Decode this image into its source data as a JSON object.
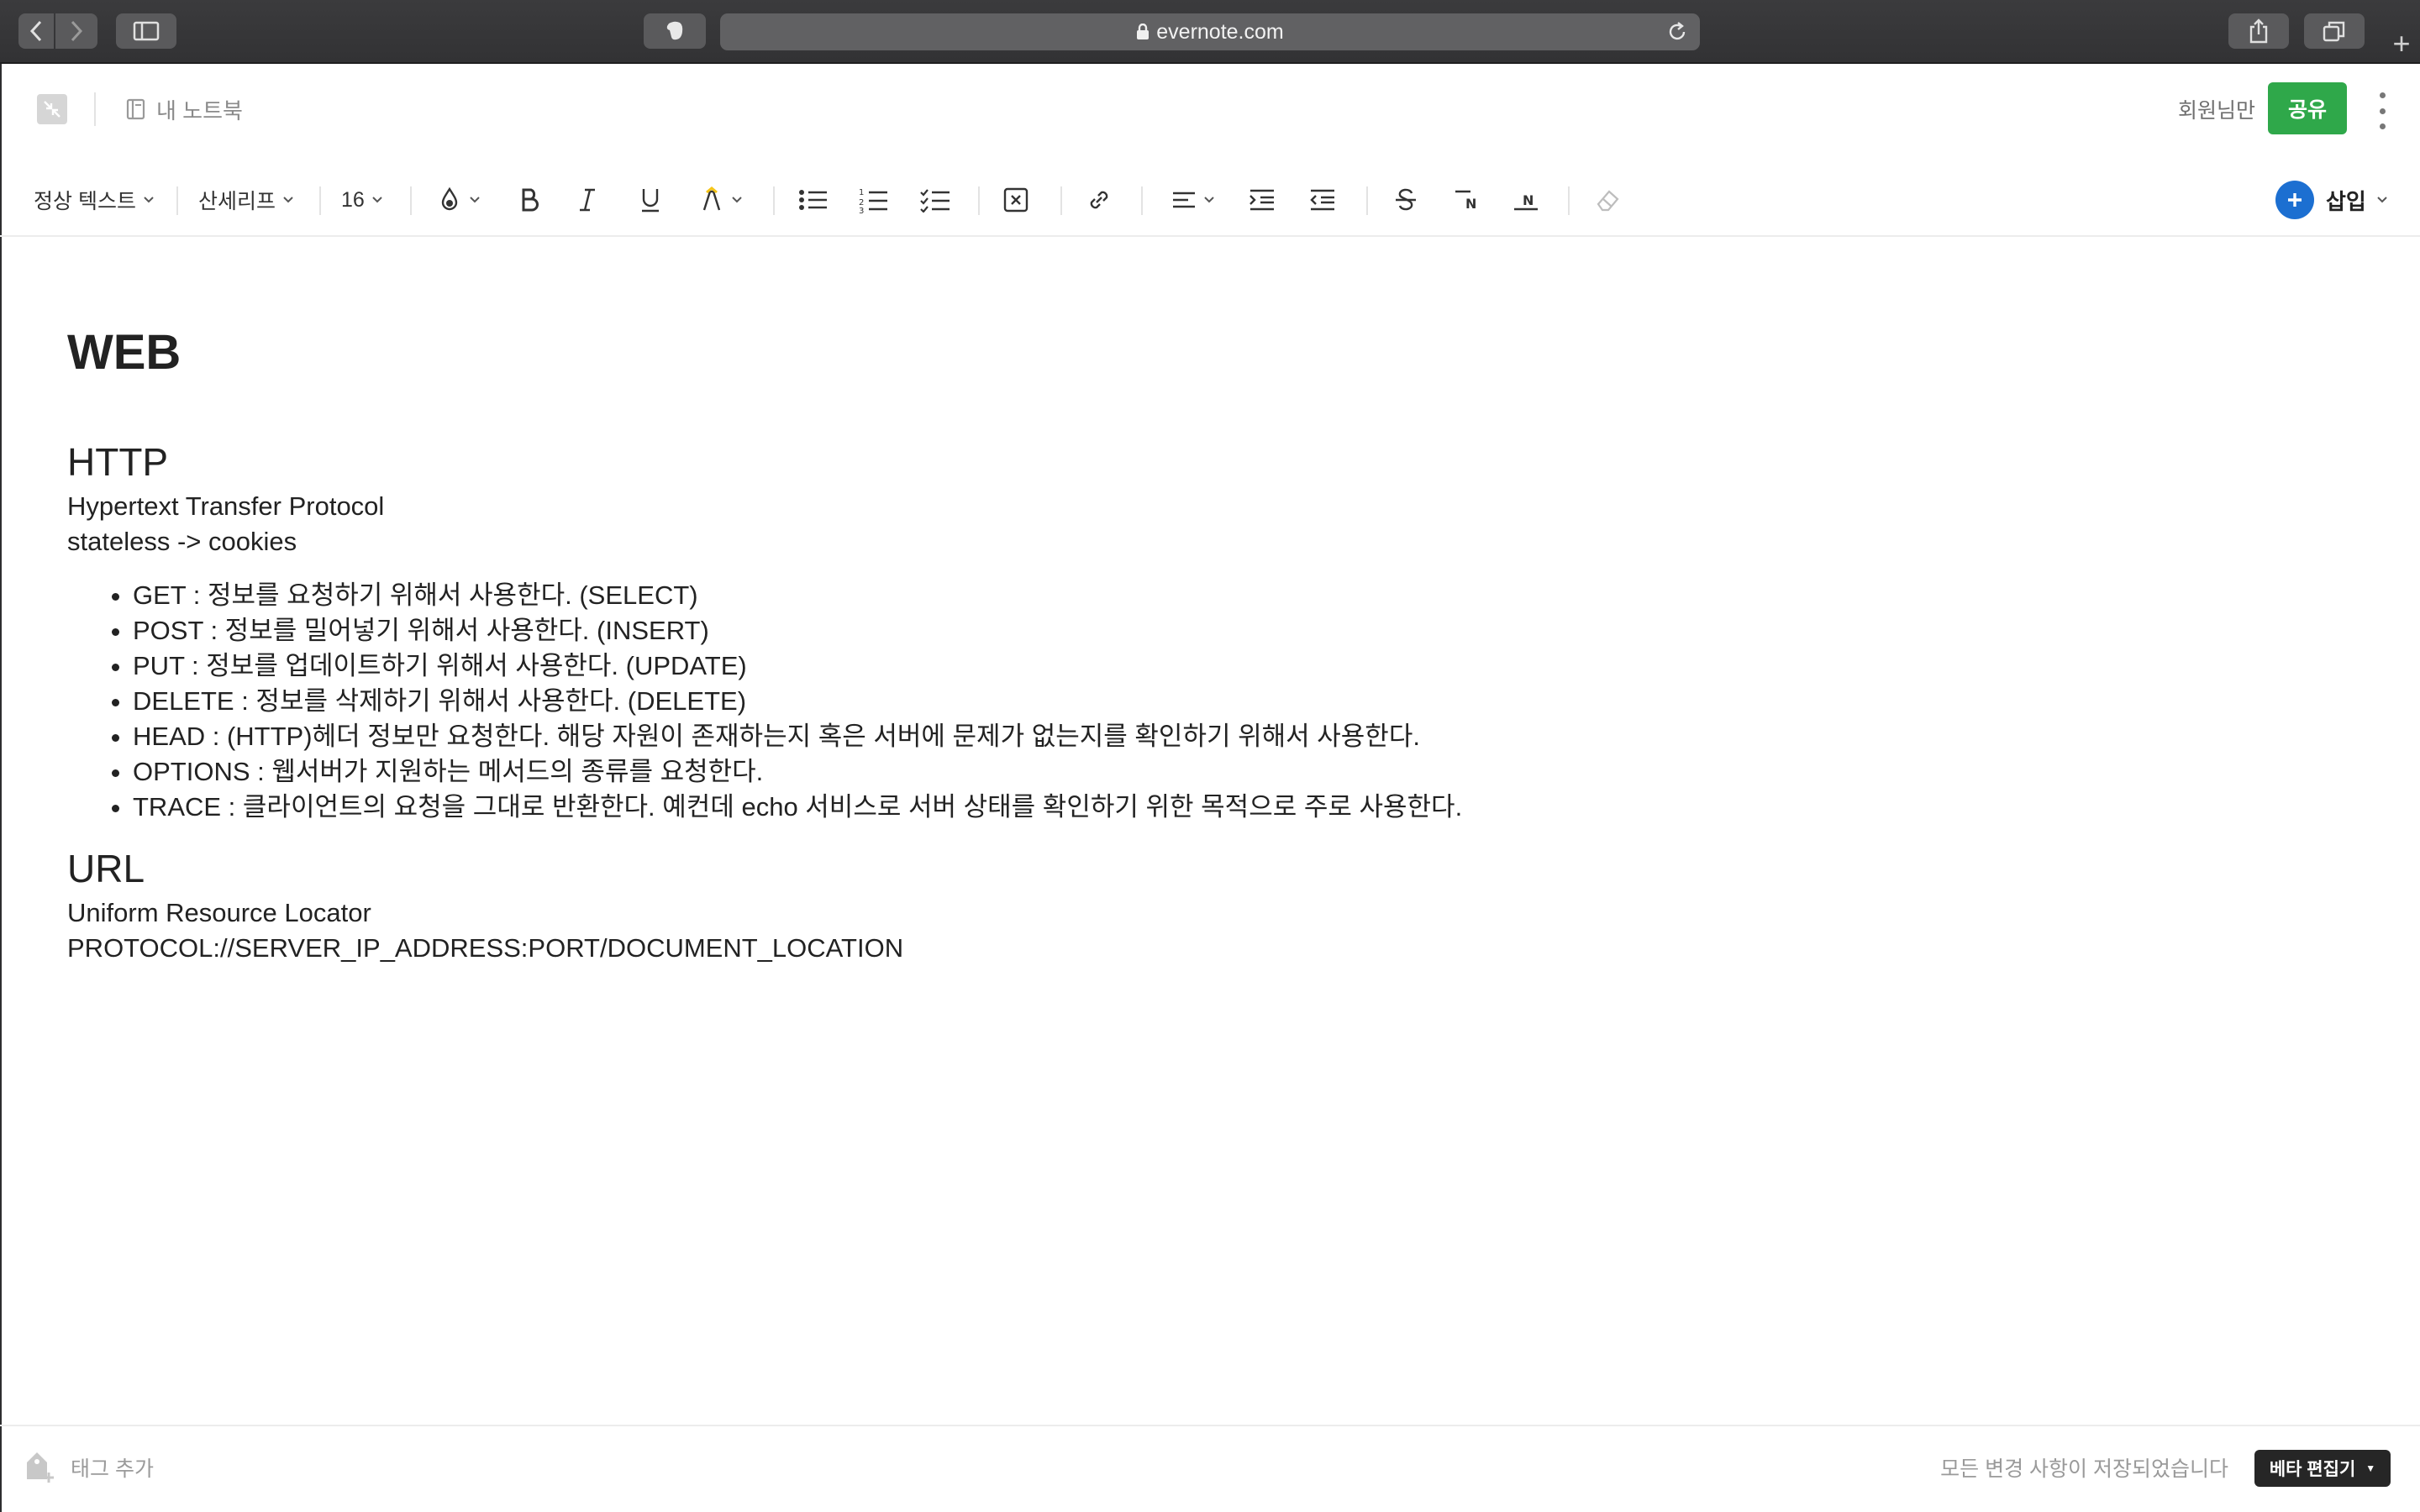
{
  "browser": {
    "url": "evernote.com",
    "icons": [
      "back-icon",
      "forward-icon",
      "sidebar-icon",
      "evernote-tab-icon",
      "lock-icon",
      "reload-icon",
      "share-icon",
      "tabs-icon",
      "new-tab-icon"
    ]
  },
  "header": {
    "notebook": "내 노트북",
    "members": "회원님만",
    "share_label": "공유"
  },
  "toolbar": {
    "paragraph_style": "정상 텍스트",
    "font": "산세리프",
    "font_size": "16",
    "insert_label": "삽입"
  },
  "note": {
    "title": "WEB",
    "http_heading": "HTTP",
    "http_lines": [
      "Hypertext Transfer Protocol",
      "stateless -> cookies"
    ],
    "methods": [
      "GET : 정보를 요청하기 위해서 사용한다. (SELECT)",
      "POST : 정보를 밀어넣기 위해서 사용한다. (INSERT)",
      "PUT : 정보를 업데이트하기 위해서 사용한다. (UPDATE)",
      "DELETE : 정보를 삭제하기 위해서 사용한다. (DELETE)",
      "HEAD : (HTTP)헤더 정보만 요청한다. 해당 자원이 존재하는지 혹은 서버에 문제가 없는지를 확인하기 위해서 사용한다.",
      "OPTIONS : 웹서버가 지원하는 메서드의 종류를 요청한다.",
      "TRACE : 클라이언트의 요청을 그대로 반환한다. 예컨데 echo 서비스로 서버 상태를 확인하기 위한 목적으로 주로 사용한다."
    ],
    "url_heading": "URL",
    "url_lines": [
      "Uniform Resource Locator",
      "PROTOCOL://SERVER_IP_ADDRESS:PORT/DOCUMENT_LOCATION"
    ]
  },
  "footer": {
    "tag_add": "태그 추가",
    "save_status": "모든 변경 사항이 저장되었습니다",
    "beta_editor": "베타 편집기"
  },
  "colors": {
    "share_green": "#2fa84a",
    "insert_blue": "#1c6fd1",
    "highlight_yellow": "#f5c518"
  }
}
